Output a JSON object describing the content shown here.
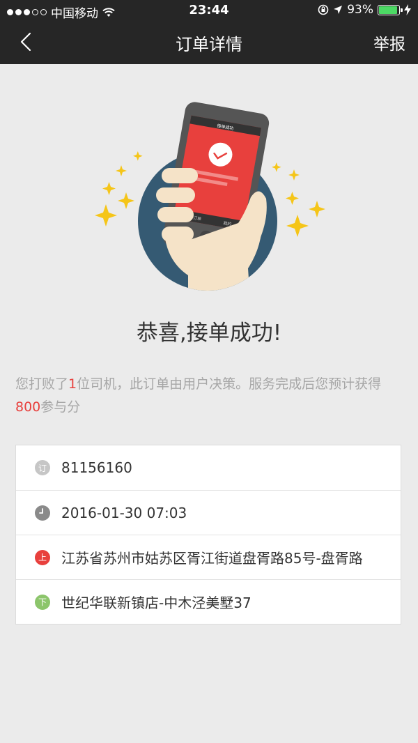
{
  "status_bar": {
    "carrier": "中国移动",
    "time": "23:44",
    "battery": "93%",
    "battery_level": 0.93
  },
  "nav": {
    "title": "订单详情",
    "report": "举报",
    "back_icon": "chevron-left-icon"
  },
  "illustration": {
    "phone_header": "接单成功",
    "phone_tabs": [
      "新订单",
      "我的"
    ]
  },
  "headline": "恭喜,接单成功!",
  "description": {
    "p1": "您打败了",
    "n1": "1",
    "p2": "位司机，此订单由用户决策。服务完成后您预计获得",
    "n2": "800",
    "p3": "参与分"
  },
  "order": {
    "rows": [
      {
        "icon": "订",
        "icon_color": "#c6c6c6",
        "value": "81156160"
      },
      {
        "icon": "clock-icon",
        "icon_color": "#8a8a8a",
        "value": "2016-01-30 07:03"
      },
      {
        "icon": "上",
        "icon_color": "#e8403d",
        "value": "江苏省苏州市姑苏区胥江街道盘胥路85号-盘胥路"
      },
      {
        "icon": "下",
        "icon_color": "#8cc56b",
        "value": "世纪华联新镇店-中木泾美墅37"
      }
    ]
  },
  "colors": {
    "nav_bg": "#262626",
    "page_bg": "#ebebeb",
    "accent_red": "#e8403d",
    "illustration_circle": "#355a73",
    "stars": "#f5c518"
  }
}
